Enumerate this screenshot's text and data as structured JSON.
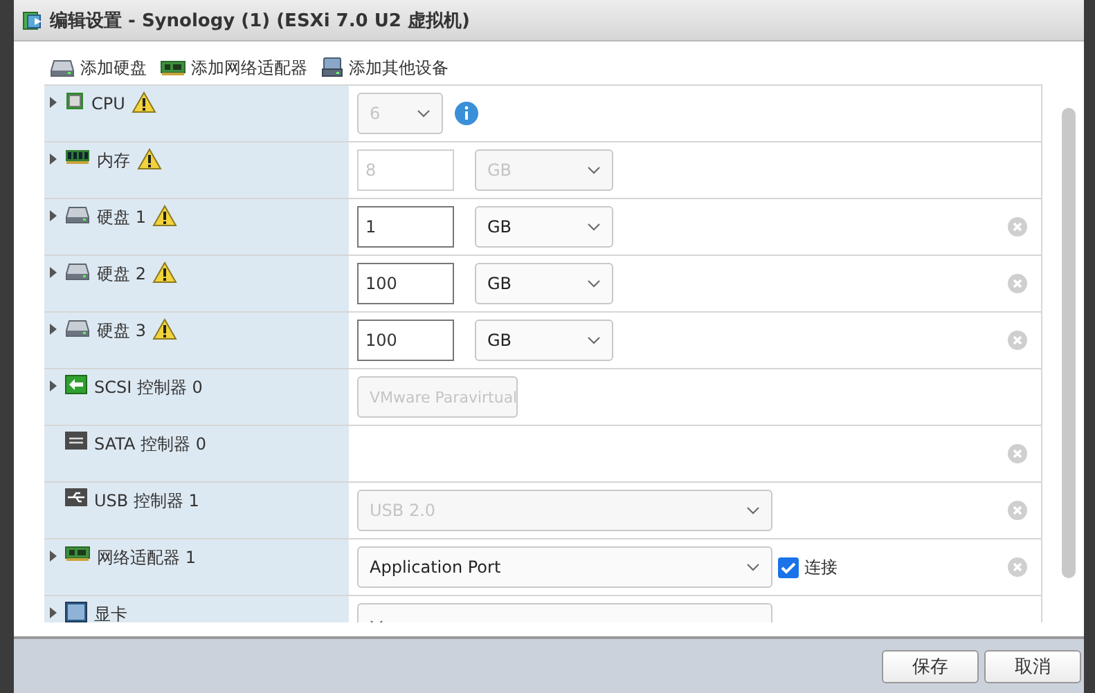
{
  "window": {
    "title": "编辑设置 - Synology (1) (ESXi 7.0 U2 虚拟机)"
  },
  "toolbar": [
    {
      "label": "添加硬盘",
      "kind": "disk"
    },
    {
      "label": "添加网络适配器",
      "kind": "nic"
    },
    {
      "label": "添加其他设备",
      "kind": "device"
    }
  ],
  "rows": [
    {
      "label": "CPU",
      "kind": "cpu",
      "expandable": true,
      "warning": true,
      "removable": false,
      "controls": [
        {
          "kind": "count",
          "value": "6",
          "disabled": true
        },
        {
          "kind": "info"
        }
      ]
    },
    {
      "label": "内存",
      "kind": "memory",
      "expandable": true,
      "warning": true,
      "removable": false,
      "controls": [
        {
          "kind": "amount",
          "value": "8",
          "disabled": true
        },
        {
          "kind": "unit",
          "value": "GB",
          "disabled": true
        }
      ]
    },
    {
      "label": "硬盘 1",
      "kind": "disk",
      "expandable": true,
      "warning": true,
      "removable": true,
      "controls": [
        {
          "kind": "amount",
          "value": "1",
          "disabled": false
        },
        {
          "kind": "unit",
          "value": "GB",
          "disabled": false
        }
      ]
    },
    {
      "label": "硬盘 2",
      "kind": "disk",
      "expandable": true,
      "warning": true,
      "removable": true,
      "controls": [
        {
          "kind": "amount",
          "value": "100",
          "disabled": false
        },
        {
          "kind": "unit",
          "value": "GB",
          "disabled": false
        }
      ]
    },
    {
      "label": "硬盘 3",
      "kind": "disk",
      "expandable": true,
      "warning": true,
      "removable": true,
      "controls": [
        {
          "kind": "amount",
          "value": "100",
          "disabled": false
        },
        {
          "kind": "unit",
          "value": "GB",
          "disabled": false
        }
      ]
    },
    {
      "label": "SCSI 控制器 0",
      "kind": "scsi",
      "expandable": true,
      "warning": false,
      "removable": false,
      "controls": [
        {
          "kind": "type",
          "value": "VMware Paravirtual",
          "disabled": true
        }
      ]
    },
    {
      "label": "SATA 控制器 0",
      "kind": "sata",
      "expandable": false,
      "warning": false,
      "removable": true,
      "controls": []
    },
    {
      "label": "USB 控制器 1",
      "kind": "usb",
      "expandable": false,
      "warning": false,
      "removable": true,
      "controls": [
        {
          "kind": "choice",
          "value": "USB 2.0",
          "disabled": true
        }
      ]
    },
    {
      "label": "网络适配器 1",
      "kind": "nic",
      "expandable": true,
      "warning": false,
      "removable": true,
      "controls": [
        {
          "kind": "choice",
          "value": "Application Port",
          "disabled": false
        },
        {
          "kind": "checkbox",
          "label": "连接",
          "checked": true
        }
      ]
    },
    {
      "label": "显卡",
      "kind": "display",
      "expandable": true,
      "warning": false,
      "removable": false,
      "controls": [
        {
          "kind": "choice"
        }
      ]
    }
  ],
  "buttons": [
    "保存",
    "取消"
  ]
}
